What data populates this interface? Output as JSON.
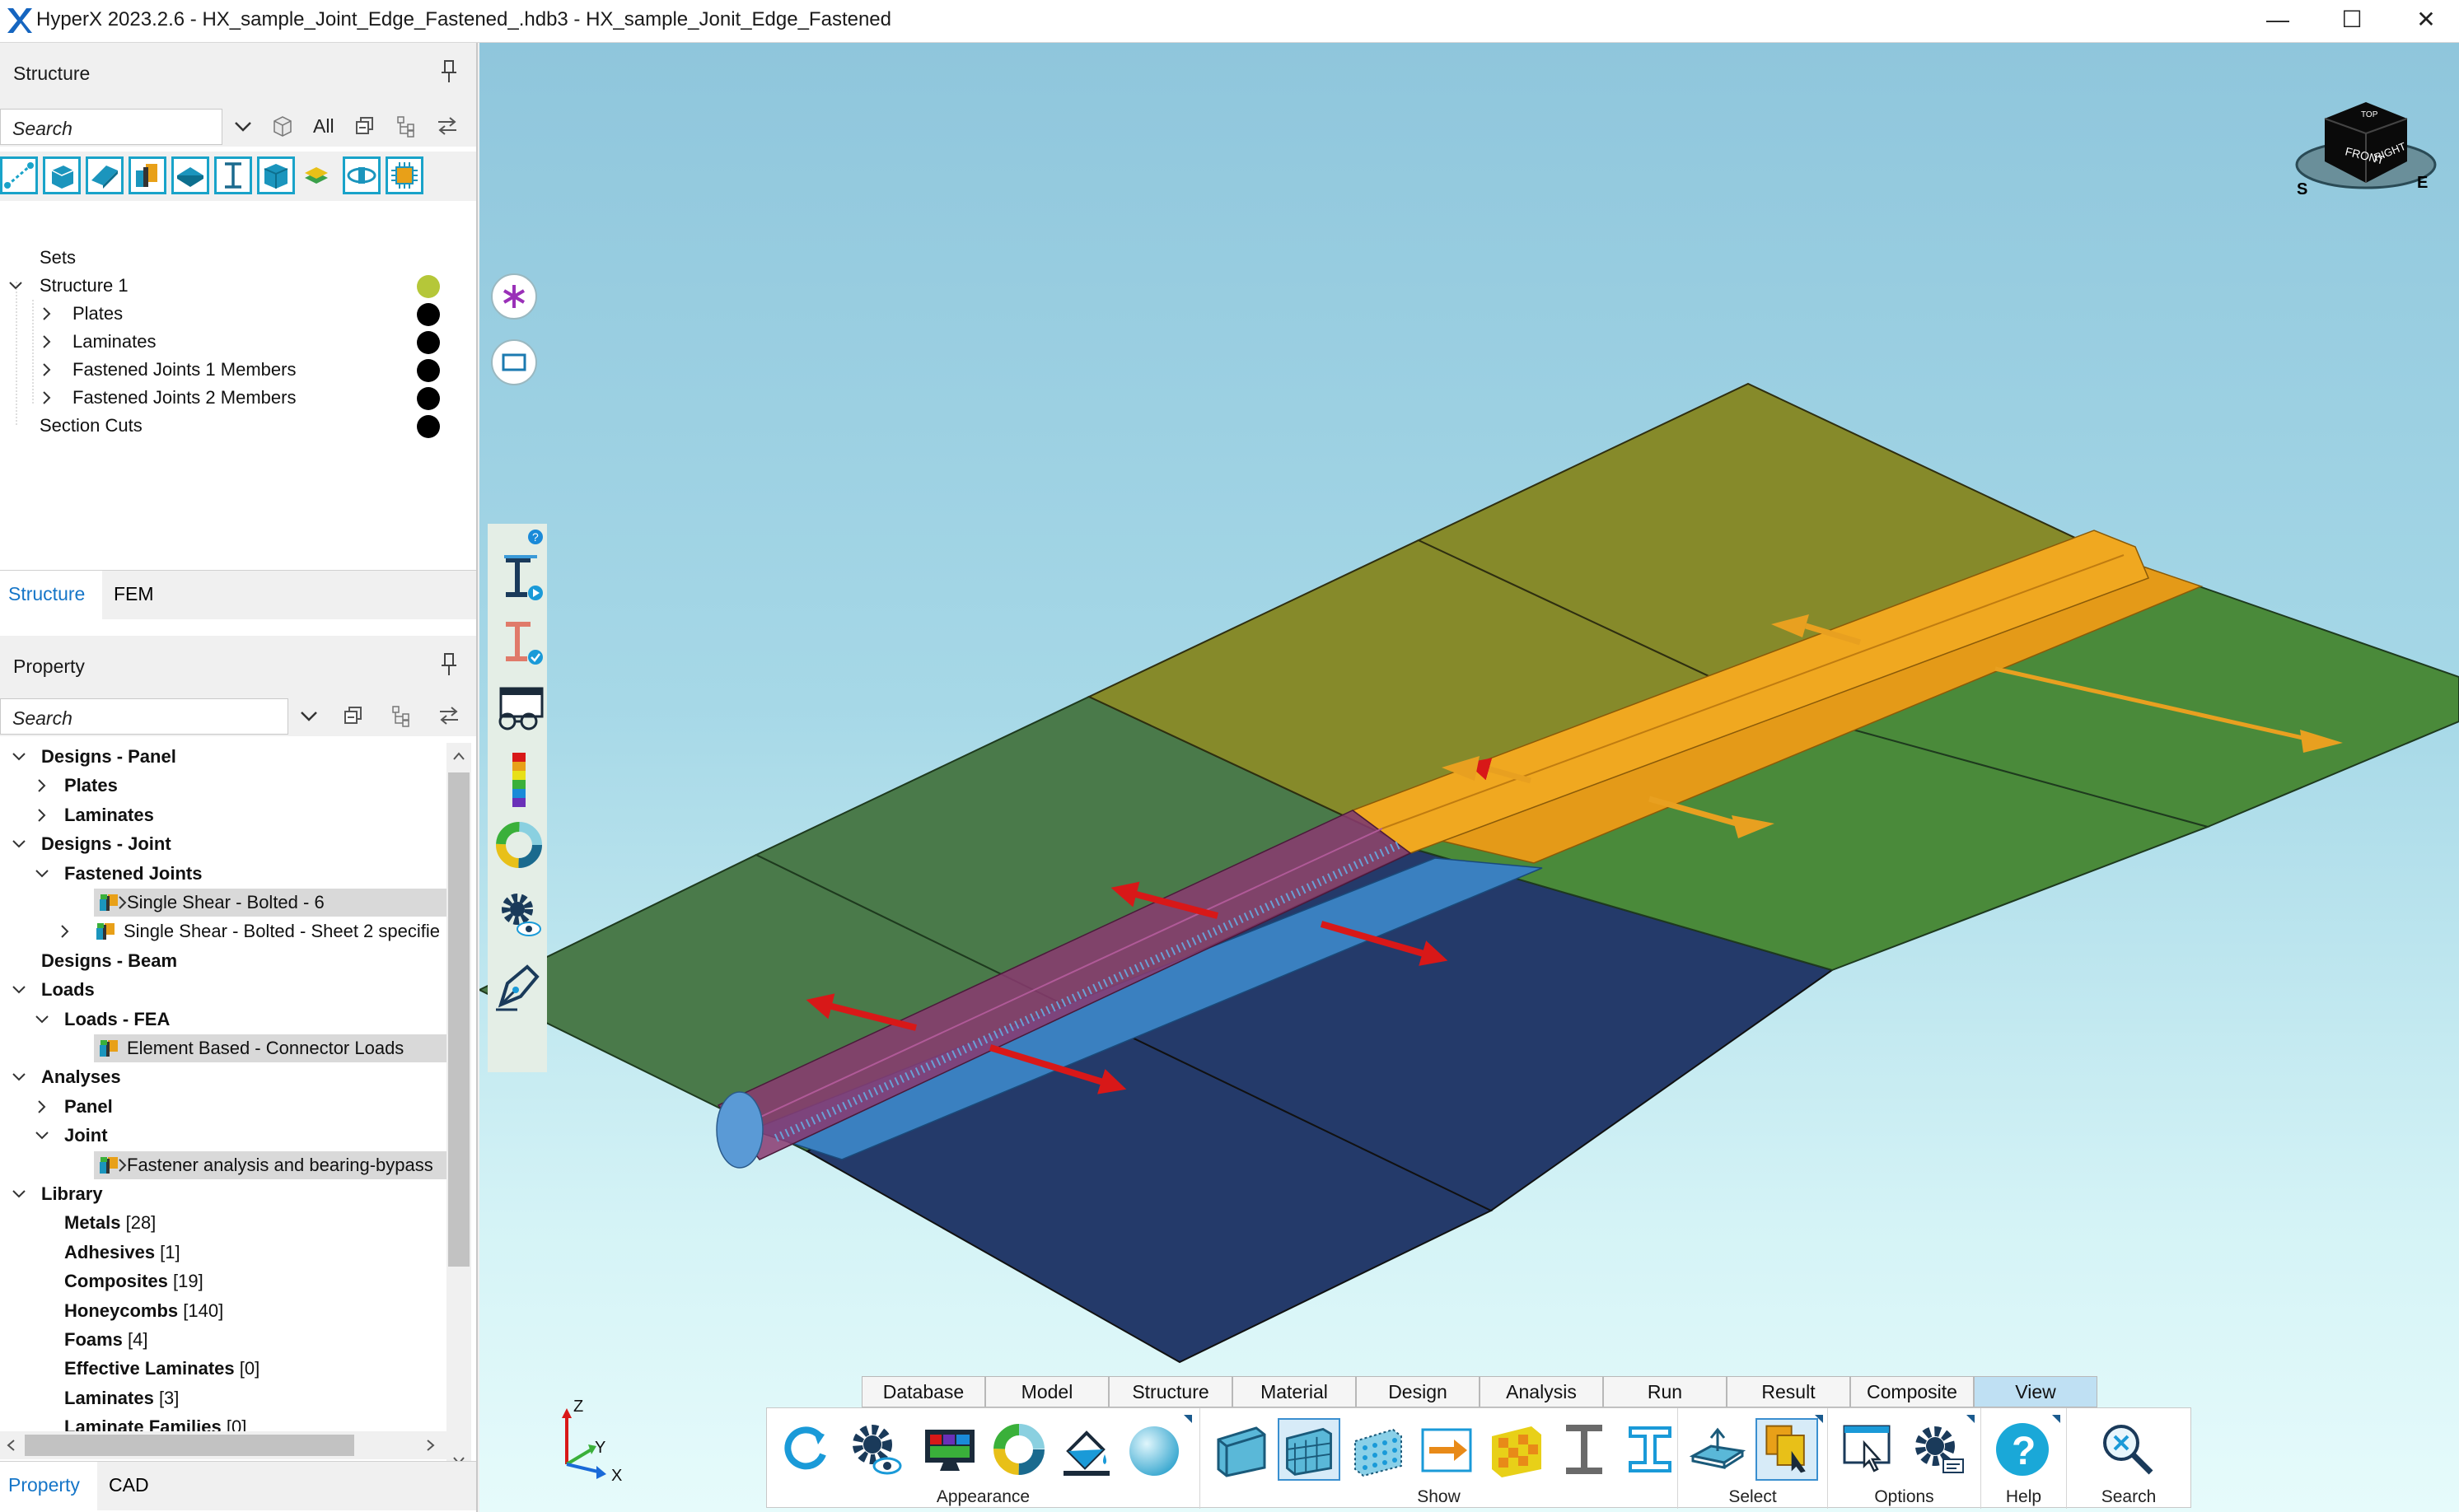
{
  "window": {
    "title": "HyperX 2023.2.6 - HX_sample_Joint_Edge_Fastened_.hdb3 - HX_sample_Jonit_Edge_Fastened",
    "minimize": "—",
    "maximize": "☐",
    "close": "✕"
  },
  "structure_pane": {
    "title": "Structure",
    "search_placeholder": "Search",
    "all_label": "All",
    "tree": {
      "sets": "Sets",
      "structure": "Structure 1",
      "plates": "Plates",
      "laminates": "Laminates",
      "fj1": "Fastened Joints 1 Members",
      "fj2": "Fastened Joints 2 Members",
      "section_cuts": "Section Cuts"
    },
    "tabs": [
      "Structure",
      "FEM"
    ]
  },
  "property_pane": {
    "title": "Property",
    "search_placeholder": "Search",
    "tree": [
      {
        "label": "Designs - Panel",
        "level": 0,
        "state": "open",
        "bold": true
      },
      {
        "label": "Plates",
        "level": 1,
        "state": "closed",
        "bold": true
      },
      {
        "label": "Laminates",
        "level": 1,
        "state": "closed",
        "bold": true
      },
      {
        "label": "Designs - Joint",
        "level": 0,
        "state": "open",
        "bold": true
      },
      {
        "label": "Fastened Joints",
        "level": 1,
        "state": "open",
        "bold": true
      },
      {
        "label": "Single Shear - Bolted - 6",
        "level": 2,
        "state": "closed",
        "icon": true,
        "selected": true
      },
      {
        "label": "Single Shear - Bolted - Sheet 2 specifie",
        "level": 2,
        "state": "closed",
        "icon": true
      },
      {
        "label": "Designs - Beam",
        "level": 0,
        "state": "none",
        "bold": true
      },
      {
        "label": "Loads",
        "level": 0,
        "state": "open",
        "bold": true
      },
      {
        "label": "Loads - FEA",
        "level": 1,
        "state": "open",
        "bold": true
      },
      {
        "label": "Element Based - Connector Loads",
        "level": 2,
        "state": "none",
        "icon": true,
        "selected": true
      },
      {
        "label": "Analyses",
        "level": 0,
        "state": "open",
        "bold": true
      },
      {
        "label": "Panel",
        "level": 1,
        "state": "closed",
        "bold": true
      },
      {
        "label": "Joint",
        "level": 1,
        "state": "open",
        "bold": true
      },
      {
        "label": "Fastener analysis and bearing-bypass",
        "level": 2,
        "state": "closed",
        "icon": true,
        "selected": true
      },
      {
        "label": "Library",
        "level": 0,
        "state": "open",
        "bold": true
      },
      {
        "label": "Metals",
        "count": "[28]",
        "level": 1,
        "state": "none",
        "bold": true
      },
      {
        "label": "Adhesives",
        "count": "[1]",
        "level": 1,
        "state": "none",
        "bold": true
      },
      {
        "label": "Composites",
        "count": "[19]",
        "level": 1,
        "state": "none",
        "bold": true
      },
      {
        "label": "Honeycombs",
        "count": "[140]",
        "level": 1,
        "state": "none",
        "bold": true
      },
      {
        "label": "Foams",
        "count": "[4]",
        "level": 1,
        "state": "none",
        "bold": true
      },
      {
        "label": "Effective Laminates",
        "count": "[0]",
        "level": 1,
        "state": "none",
        "bold": true
      },
      {
        "label": "Laminates",
        "count": "[3]",
        "level": 1,
        "state": "none",
        "bold": true
      },
      {
        "label": "Laminate Families",
        "count": "[0]",
        "level": 1,
        "state": "none",
        "bold": true
      }
    ],
    "tabs": [
      "Property",
      "CAD"
    ]
  },
  "viewcube": {
    "front": "FRONT",
    "right": "RIGHT",
    "top": "TOP",
    "south": "S",
    "east": "E"
  },
  "axes": {
    "x": "X",
    "y": "Y",
    "z": "Z"
  },
  "ribbon": {
    "tabs": [
      "Database",
      "Model",
      "Structure",
      "Material",
      "Design",
      "Analysis",
      "Run",
      "Result",
      "Composite",
      "View"
    ],
    "active_tab": "View",
    "groups": [
      "Appearance",
      "Show",
      "Select",
      "Options",
      "Help",
      "Search"
    ]
  },
  "colors": {
    "accent": "#19a3c9",
    "panel_green": "#4a7a4a",
    "panel_olive": "#868a2a",
    "panel_navy": "#243a6a",
    "joint_orange": "#e49a18",
    "joint_purple": "#8a3a70",
    "load_red": "#d81818"
  }
}
